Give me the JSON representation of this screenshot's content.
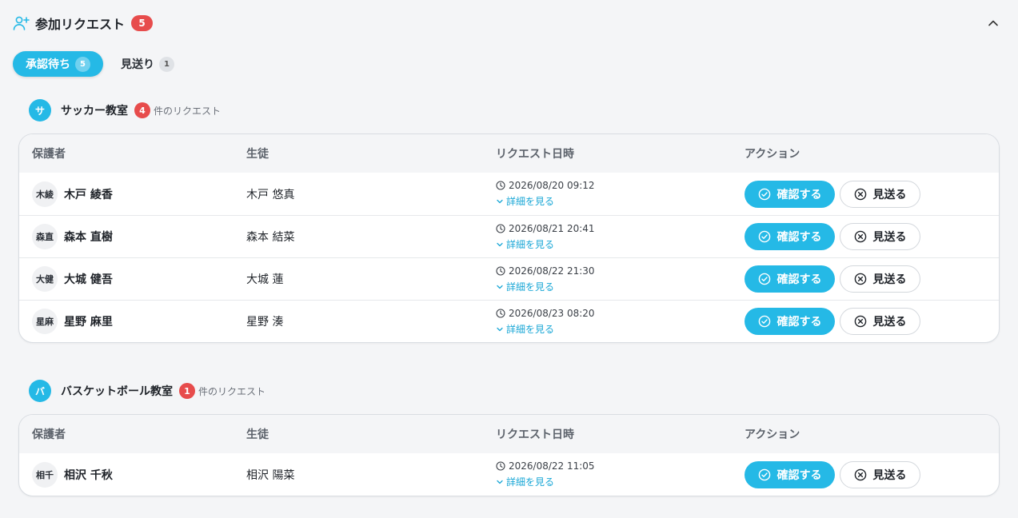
{
  "header": {
    "title": "参加リクエスト",
    "count": "5"
  },
  "tabs": [
    {
      "label": "承認待ち",
      "count": "5"
    },
    {
      "label": "見送り",
      "count": "1"
    }
  ],
  "table_headers": {
    "guardian": "保護者",
    "student": "生徒",
    "date": "リクエスト日時",
    "action": "アクション"
  },
  "actions": {
    "confirm": "確認する",
    "skip": "見送る",
    "detail": "詳細を見る"
  },
  "colors": {
    "accent": "#25b9e6",
    "badge": "#e74c4c"
  },
  "groups": [
    {
      "avatar": "サ",
      "name": "サッカー教室",
      "count": "4",
      "suffix": "件のリクエスト",
      "rows": [
        {
          "initials": "木綾",
          "guardian": "木戸 綾香",
          "student": "木戸 悠真",
          "date": "2026/08/20 09:12"
        },
        {
          "initials": "森直",
          "guardian": "森本 直樹",
          "student": "森本 結菜",
          "date": "2026/08/21 20:41"
        },
        {
          "initials": "大健",
          "guardian": "大城 健吾",
          "student": "大城 蓮",
          "date": "2026/08/22 21:30"
        },
        {
          "initials": "星麻",
          "guardian": "星野 麻里",
          "student": "星野 湊",
          "date": "2026/08/23 08:20"
        }
      ]
    },
    {
      "avatar": "バ",
      "name": "バスケットボール教室",
      "count": "1",
      "suffix": "件のリクエスト",
      "rows": [
        {
          "initials": "相千",
          "guardian": "相沢 千秋",
          "student": "相沢 陽菜",
          "date": "2026/08/22 11:05"
        }
      ]
    }
  ]
}
